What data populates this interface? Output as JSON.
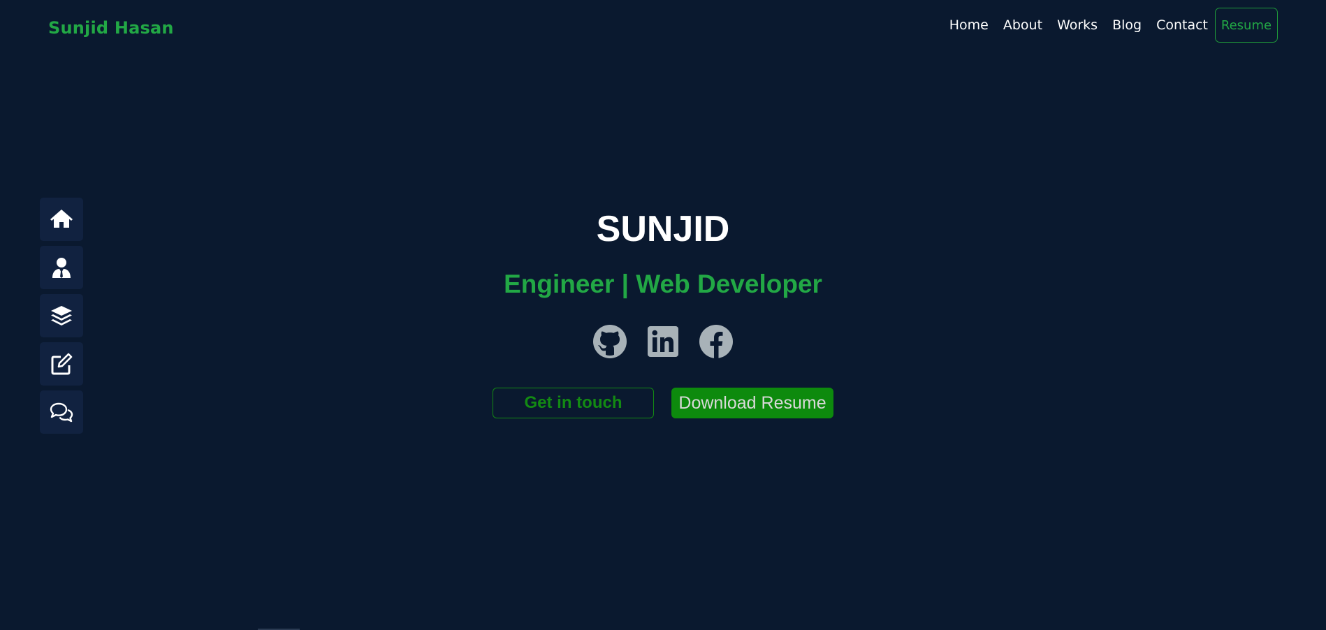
{
  "header": {
    "brand": "Sunjid Hasan",
    "nav": [
      {
        "label": "Home"
      },
      {
        "label": "About"
      },
      {
        "label": "Works"
      },
      {
        "label": "Blog"
      },
      {
        "label": "Contact"
      }
    ],
    "resume_label": "Resume"
  },
  "side_nav": [
    {
      "icon": "home-icon"
    },
    {
      "icon": "user-tie-icon"
    },
    {
      "icon": "layers-icon"
    },
    {
      "icon": "edit-icon"
    },
    {
      "icon": "comments-icon"
    }
  ],
  "hero": {
    "name": "SUNJID",
    "title": "Engineer | Web Developer",
    "socials": [
      {
        "icon": "github-icon"
      },
      {
        "icon": "linkedin-icon"
      },
      {
        "icon": "facebook-icon"
      }
    ],
    "cta_primary": "Get in touch",
    "cta_secondary": "Download Resume"
  },
  "colors": {
    "background": "#0a192f",
    "panel": "#112240",
    "accent": "#22a845",
    "button_green": "#0d8a0d",
    "social_gray": "#a8b2b8"
  }
}
